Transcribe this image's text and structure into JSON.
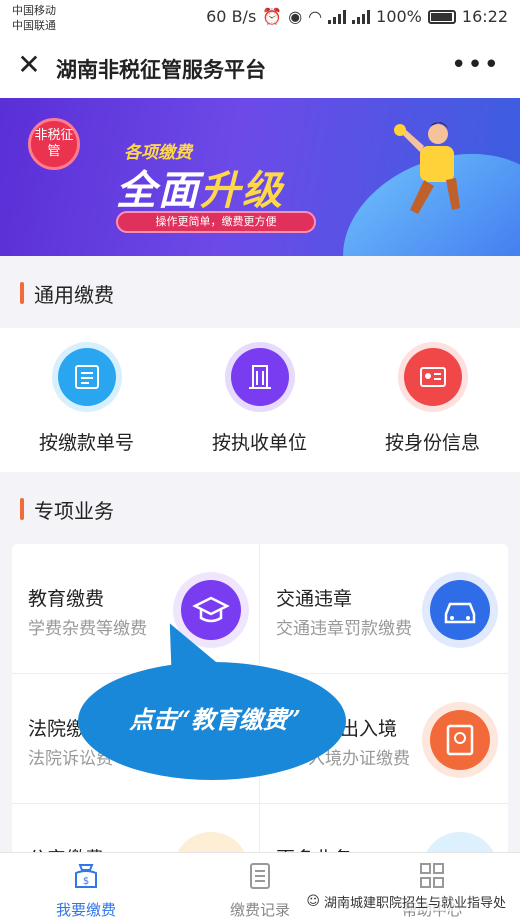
{
  "status_bar": {
    "carrier_1": "中国移动",
    "carrier_2": "中国联通",
    "speed": "60 B/s",
    "battery": "100%",
    "time": "16:22"
  },
  "nav": {
    "title": "湖南非税征管服务平台",
    "more": "•••",
    "close": "✕"
  },
  "banner": {
    "badge": "非税征管",
    "subtitle": "各项缴费",
    "main_left": "全面",
    "main_right": "升级",
    "pill": "操作更简单，缴费更方便"
  },
  "general_section": {
    "title": "通用缴费",
    "items": [
      {
        "label": "按缴款单号",
        "icon": "document-icon",
        "color": "#2aa6f0"
      },
      {
        "label": "按执收单位",
        "icon": "building-icon",
        "color": "#7a3cf0"
      },
      {
        "label": "按身份信息",
        "icon": "id-card-icon",
        "color": "#f04848"
      }
    ]
  },
  "special_section": {
    "title": "专项业务",
    "items": [
      {
        "title": "教育缴费",
        "desc": "学费杂费等缴费",
        "icon": "graduation-cap-icon",
        "color": "#7a3cf0"
      },
      {
        "title": "交通违章",
        "desc": "交通违章罚款缴费",
        "icon": "car-icon",
        "color": "#2f6ce8"
      },
      {
        "title": "法院缴",
        "desc": "法院诉讼费",
        "icon": "court-icon",
        "color": "#f0a020"
      },
      {
        "title": "出入境",
        "desc": "入境办证缴费",
        "icon": "passport-icon",
        "color": "#f26a3a"
      },
      {
        "title": "公安缴费",
        "desc": "",
        "icon": "police-icon",
        "color": "#f0a020"
      },
      {
        "title": "更多业务",
        "desc": "",
        "icon": "more-icon",
        "color": "#2aa6f0"
      }
    ]
  },
  "callout": {
    "text": "点击“教育缴费”"
  },
  "tabs": [
    {
      "label": "我要缴费",
      "icon": "wallet-icon",
      "active": true
    },
    {
      "label": "缴费记录",
      "icon": "list-icon",
      "active": false
    },
    {
      "label": "帮助中心",
      "icon": "grid-icon",
      "active": false
    }
  ],
  "watermark": "湖南城建职院招生与就业指导处",
  "colors": {
    "accent": "#2f78e8",
    "section_bar": "#f06a3a",
    "banner": "#5a2fd6"
  }
}
